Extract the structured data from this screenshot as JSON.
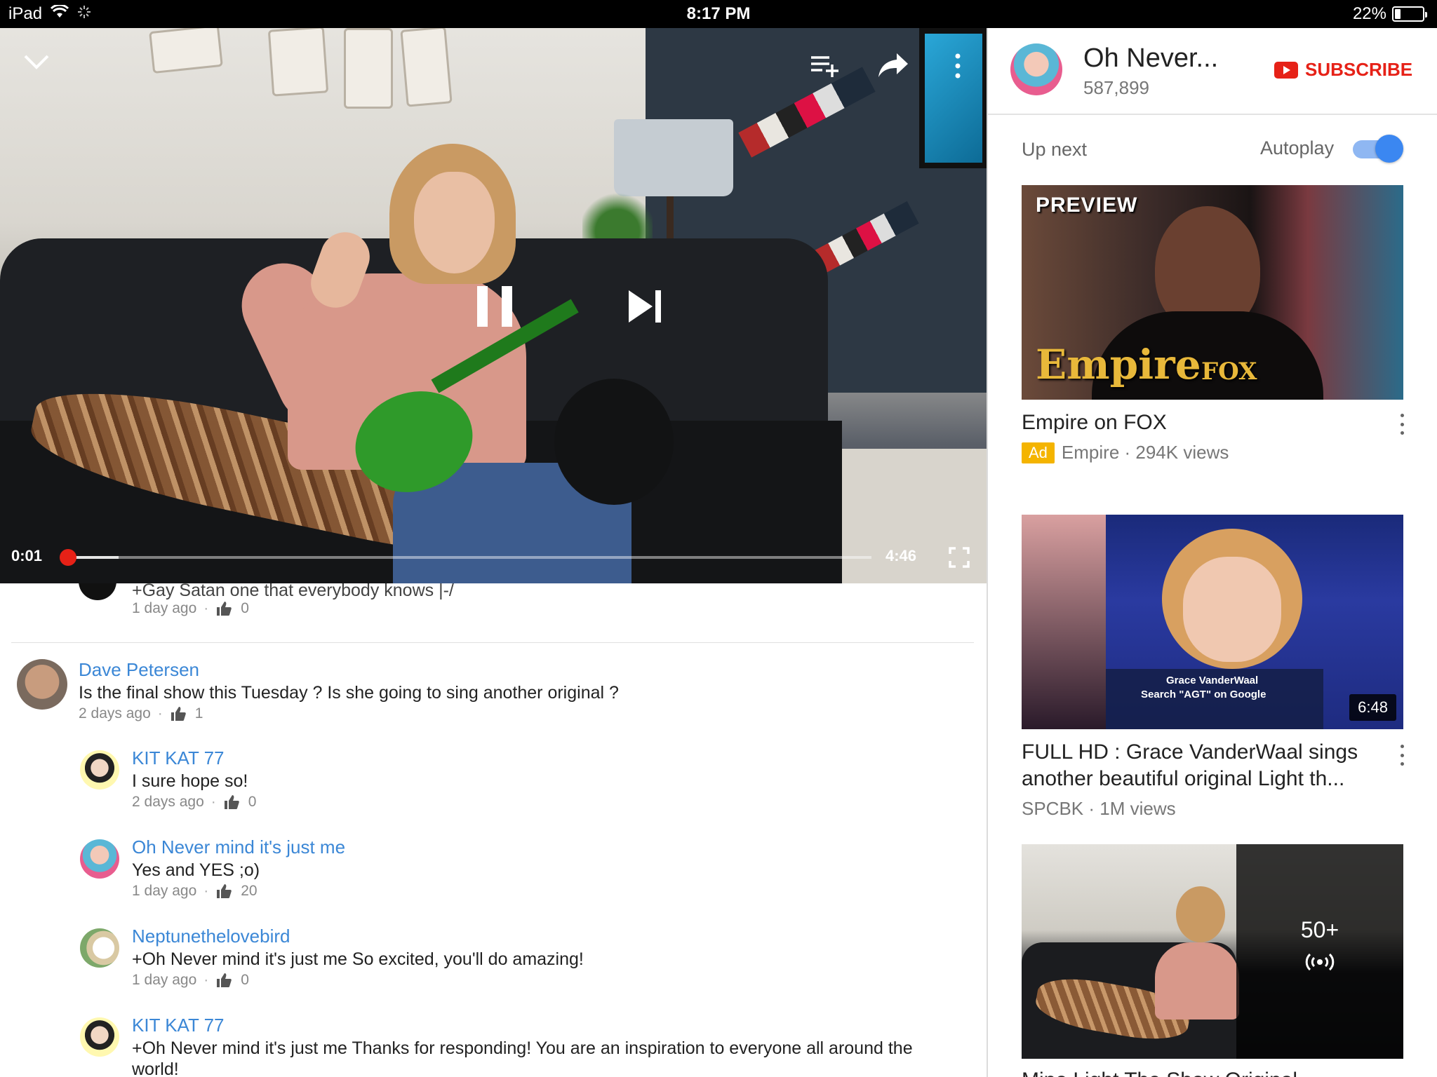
{
  "status_bar": {
    "device": "iPad",
    "time": "8:17 PM",
    "battery": "22%",
    "battery_level": 0.22
  },
  "player": {
    "current_time": "0:01",
    "duration": "4:46",
    "played_fraction": 0.003,
    "buffered_fraction": 0.065,
    "icons": [
      "chevron-down-icon",
      "add-to-playlist-icon",
      "share-icon",
      "more-vert-icon",
      "pause-icon",
      "skip-next-icon",
      "fullscreen-icon"
    ]
  },
  "comments": {
    "partial_top": {
      "text": "+Gay Satan one that everybody knows |-/",
      "age": "1 day ago",
      "likes": "0"
    },
    "items": [
      {
        "name": "Dave Petersen",
        "text": "Is the final show this Tuesday ?   Is she going to sing another original ?",
        "age": "2 days ago",
        "likes": "1"
      },
      {
        "name": "KIT KAT 77",
        "text": "I sure hope so!",
        "age": "2 days ago",
        "likes": "0"
      },
      {
        "name": "Oh Never mind it's just me",
        "text": "Yes and YES ;o)",
        "age": "1 day ago",
        "likes": "20"
      },
      {
        "name": "Neptunethelovebird",
        "text": "+Oh Never mind it's just me So excited, you'll do amazing!",
        "age": "1 day ago",
        "likes": "0"
      },
      {
        "name": "KIT KAT 77",
        "text": "+Oh Never mind it's just me Thanks for responding! You are an inspiration to everyone all around the",
        "text2": "world!",
        "age": "",
        "likes": ""
      }
    ]
  },
  "channel": {
    "name": "Oh Never...",
    "subscribers": "587,899",
    "subscribe_label": "SUBSCRIBE"
  },
  "up_next": {
    "label": "Up next",
    "autoplay_label": "Autoplay",
    "autoplay_on": true,
    "videos": [
      {
        "title": "Empire on FOX",
        "ad": "Ad",
        "meta": "Empire · 294K views",
        "thumb_text_1": "PREVIEW",
        "thumb_text_2": "Empire",
        "thumb_text_3": "FOX"
      },
      {
        "title_line1": "FULL HD : Grace VanderWaal sings",
        "title_line2": "another beautiful original Light th...",
        "meta": "SPCBK · 1M views",
        "duration": "6:48",
        "thumb_text_1": "Grace VanderWaal",
        "thumb_text_2": "Search \"AGT\" on Google"
      },
      {
        "overlay_count": "50+",
        "overlay_icon": "live-broadcast-icon",
        "partial_title": "Mine Light The Show Original  ·"
      }
    ]
  },
  "colors": {
    "brand_red": "#e62117",
    "link_blue": "#3b87d6",
    "toggle_blue": "#3b87f1",
    "ad_yellow": "#f4b400"
  }
}
